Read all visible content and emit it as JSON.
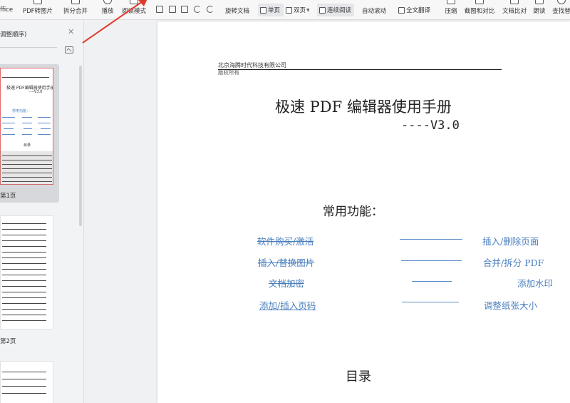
{
  "toolbar": {
    "items": [
      {
        "label": "ffice"
      },
      {
        "label": "PDF转图片"
      },
      {
        "label": "拆分合并"
      },
      {
        "label": "播放"
      },
      {
        "label": "阅读模式"
      },
      {
        "label": "旋转文档"
      },
      {
        "label": "单页"
      },
      {
        "label": "双页"
      },
      {
        "label": "连续阅读"
      },
      {
        "label": "自动滚动"
      },
      {
        "label": "全文翻译"
      },
      {
        "label": "压缩"
      },
      {
        "label": "截图和对比"
      },
      {
        "label": "文档比对"
      },
      {
        "label": "朗读"
      },
      {
        "label": "查找替"
      }
    ]
  },
  "panel": {
    "title": "调整顺序)",
    "pages": [
      {
        "label": "第1页",
        "selected": true
      },
      {
        "label": "第2页",
        "selected": false
      }
    ],
    "thumb1": {
      "title": "极速 PDF编辑器使用手册",
      "version": "----V3.0",
      "features": "常用功能：",
      "toc": "目录"
    }
  },
  "document": {
    "company": "北京海腾时代科技有限公司",
    "rights": "版权所有",
    "title": "极速  PDF 编辑器使用手册",
    "version": "----V3.0",
    "features_title": "常用功能：",
    "features": [
      {
        "left": "软件购买/激活",
        "right": "插入/删除页面"
      },
      {
        "left": "插入/替换图片",
        "right": "合并/拆分  PDF"
      },
      {
        "left": "文档加密",
        "right": "添加水印"
      },
      {
        "left": "添加/插入页码",
        "right": "调整纸张大小"
      }
    ],
    "toc_title": "目录"
  },
  "colors": {
    "link": "#4a7fbf",
    "arrow": "#e03a2f",
    "selected_thumb": "#d7d8dc"
  }
}
